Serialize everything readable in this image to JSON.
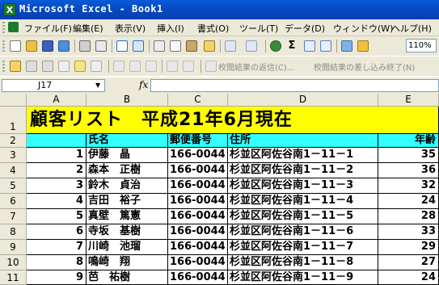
{
  "window": {
    "title": "Microsoft Excel - Book1",
    "icon": "excel-icon"
  },
  "menu": [
    "ファイル(F)",
    "編集(E)",
    "表示(V)",
    "挿入(I)",
    "書式(O)",
    "ツール(T)",
    "データ(D)",
    "ウィンドウ(W)",
    "ヘルプ(H)"
  ],
  "toolbar": {
    "zoom": "110%"
  },
  "review_toolbar": {
    "reply_label": "校閲結果の返信(C)...",
    "end_review_label": "校閲結果の差し込み終了(N)"
  },
  "formula_bar": {
    "name_box": "J17",
    "fx_label": "fx",
    "formula": ""
  },
  "columns": [
    "A",
    "B",
    "C",
    "D",
    "E"
  ],
  "rows": [
    "1",
    "2",
    "3",
    "4",
    "5",
    "6",
    "7",
    "8",
    "9",
    "10",
    "11"
  ],
  "sheet": {
    "title": "顧客リスト　平成21年6月現在",
    "headers": {
      "name": "氏名",
      "postal": "郵便番号",
      "address": "住所",
      "age": "年齢"
    },
    "records": [
      {
        "no": "1",
        "name": "伊藤　晶",
        "postal": "166-0044",
        "address": "杉並区阿佐谷南1－11－1",
        "age": "35"
      },
      {
        "no": "2",
        "name": "森本　正樹",
        "postal": "166-0044",
        "address": "杉並区阿佐谷南1－11－2",
        "age": "36"
      },
      {
        "no": "3",
        "name": "鈴木　貞治",
        "postal": "166-0044",
        "address": "杉並区阿佐谷南1－11－3",
        "age": "32"
      },
      {
        "no": "4",
        "name": "吉田　裕子",
        "postal": "166-0044",
        "address": "杉並区阿佐谷南1－11－4",
        "age": "24"
      },
      {
        "no": "5",
        "name": "真壁　篤憲",
        "postal": "166-0044",
        "address": "杉並区阿佐谷南1－11－5",
        "age": "28"
      },
      {
        "no": "6",
        "name": "寺坂　基樹",
        "postal": "166-0044",
        "address": "杉並区阿佐谷南1－11－6",
        "age": "33"
      },
      {
        "no": "7",
        "name": "川崎　池瑠",
        "postal": "166-0044",
        "address": "杉並区阿佐谷南1－11－7",
        "age": "29"
      },
      {
        "no": "8",
        "name": "鳴崎　翔",
        "postal": "166-0044",
        "address": "杉並区阿佐谷南1－11－8",
        "age": "27"
      },
      {
        "no": "9",
        "name": "芭　祐樹",
        "postal": "166-0044",
        "address": "杉並区阿佐谷南1－11－9",
        "age": "24"
      }
    ]
  },
  "colors": {
    "title_fill": "#ffff00",
    "header_fill": "#33ffff",
    "titlebar": "#0548c0"
  }
}
